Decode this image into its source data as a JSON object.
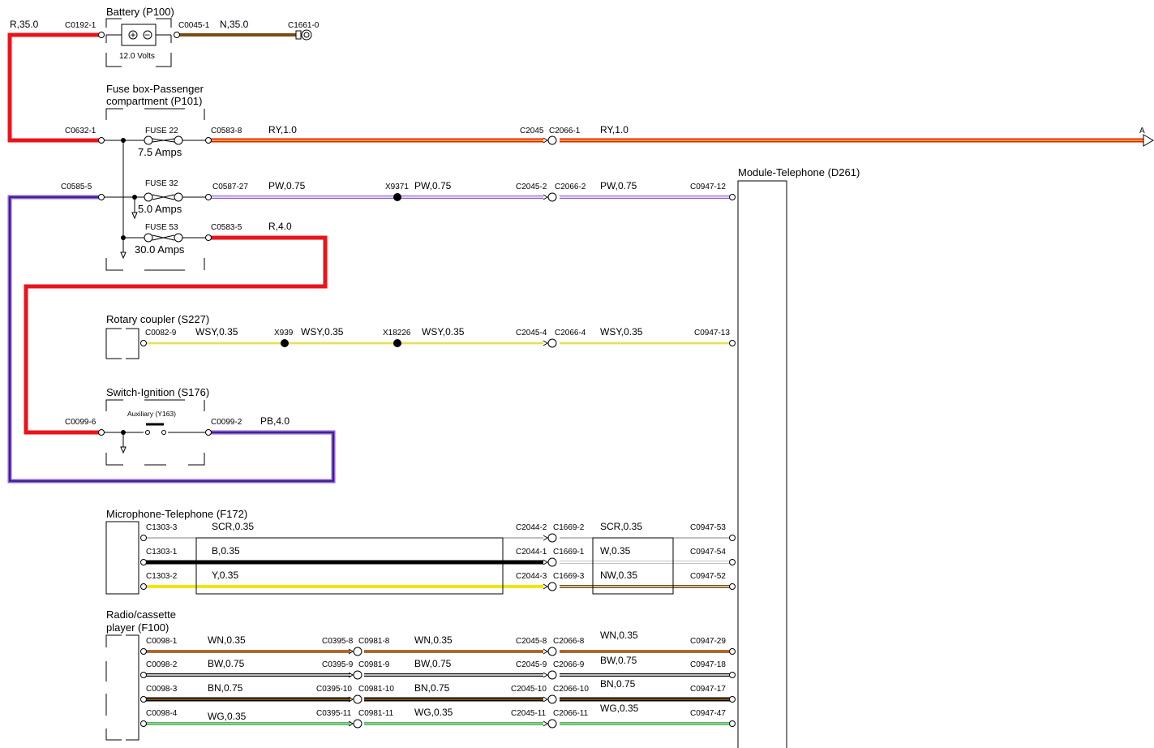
{
  "components": {
    "battery": {
      "title": "Battery (P100)",
      "voltage": "12.0 Volts",
      "plus": "+",
      "minus": "−"
    },
    "fusebox": {
      "title_line1": "Fuse box-Passenger",
      "title_line2": "compartment (P101)"
    },
    "fuses": [
      {
        "name": "FUSE 22",
        "rating": "7.5 Amps"
      },
      {
        "name": "FUSE 32",
        "rating": "5.0 Amps"
      },
      {
        "name": "FUSE 53",
        "rating": "30.0 Amps"
      }
    ],
    "module": {
      "title": "Module-Telephone (D261)"
    },
    "rotary": {
      "title": "Rotary coupler (S227)"
    },
    "ignition": {
      "title": "Switch-Ignition (S176)",
      "aux": "Auxiliary (Y163)"
    },
    "microphone": {
      "title": "Microphone-Telephone (F172)"
    },
    "radio": {
      "title_line1": "Radio/cassette",
      "title_line2": "player (F100)"
    }
  },
  "connectors": {
    "c0192_1": "C0192-1",
    "c0045_1": "C0045-1",
    "c1661_0": "C1661-0",
    "c0632_1": "C0632-1",
    "c0583_8": "C0583-8",
    "c2045": "C2045",
    "c2066_1": "C2066-1",
    "arrow_a": "A",
    "c0585_5": "C0585-5",
    "c0587_27": "C0587-27",
    "x9371": "X9371",
    "c2045_2": "C2045-2",
    "c2066_2": "C2066-2",
    "c0947_12": "C0947-12",
    "c0583_5": "C0583-5",
    "c0082_9": "C0082-9",
    "x939": "X939",
    "x18226": "X18226",
    "c2045_4": "C2045-4",
    "c2066_4": "C2066-4",
    "c0947_13": "C0947-13",
    "c0099_6": "C0099-6",
    "c0099_2": "C0099-2",
    "c1303_3": "C1303-3",
    "c1303_1": "C1303-1",
    "c1303_2": "C1303-2",
    "c2044_2": "C2044-2",
    "c1669_2": "C1669-2",
    "c0947_53": "C0947-53",
    "c2044_1": "C2044-1",
    "c1669_1": "C1669-1",
    "c0947_54": "C0947-54",
    "c2044_3": "C2044-3",
    "c1669_3": "C1669-3",
    "c0947_52": "C0947-52",
    "c0098_1": "C0098-1",
    "c0395_8": "C0395-8",
    "c0981_8": "C0981-8",
    "c2045_8": "C2045-8",
    "c2066_8": "C2066-8",
    "c0947_29": "C0947-29",
    "c0098_2": "C0098-2",
    "c0395_9": "C0395-9",
    "c0981_9": "C0981-9",
    "c2045_9": "C2045-9",
    "c2066_9": "C2066-9",
    "c0947_18": "C0947-18",
    "c0098_3": "C0098-3",
    "c0395_10": "C0395-10",
    "c0981_10": "C0981-10",
    "c2045_10": "C2045-10",
    "c2066_10": "C2066-10",
    "c0947_17": "C0947-17",
    "c0098_4": "C0098-4",
    "c0395_11": "C0395-11",
    "c0981_11": "C0981-11",
    "c2045_11": "C2045-11",
    "c2066_11": "C2066-11",
    "c0947_47": "C0947-47"
  },
  "wires": {
    "r35": "R,35.0",
    "n35": "N,35.0",
    "ry10_a": "RY,1.0",
    "ry10_b": "RY,1.0",
    "pw075_a": "PW,0.75",
    "pw075_b": "PW,0.75",
    "pw075_c": "PW,0.75",
    "r40": "R,4.0",
    "wsy_a": "WSY,0.35",
    "wsy_b": "WSY,0.35",
    "wsy_c": "WSY,0.35",
    "wsy_d": "WSY,0.35",
    "pb40": "PB,4.0",
    "scr_a": "SCR,0.35",
    "scr_b": "SCR,0.35",
    "b035": "B,0.35",
    "w035": "W,0.35",
    "y035": "Y,0.35",
    "nw035": "NW,0.35",
    "wn_a": "WN,0.35",
    "wn_b": "WN,0.35",
    "wn_c": "WN,0.35",
    "bw_a": "BW,0.75",
    "bw_b": "BW,0.75",
    "bw_c": "BW,0.75",
    "bn_a": "BN,0.75",
    "bn_b": "BN,0.75",
    "bn_c": "BN,0.75",
    "wg_a": "WG,0.35",
    "wg_b": "WG,0.35",
    "wg_c": "WG,0.35"
  },
  "colors": {
    "red": "#e8141b",
    "brown": "#7a4a12",
    "yellow": "#f2e600",
    "purple": "#8e5cd6",
    "navy": "#1c1a6e",
    "black": "#000000",
    "white": "#ffffff",
    "green": "#1f9a2a",
    "orange": "#e36a10",
    "pale_yellow": "#f4ee6a"
  }
}
